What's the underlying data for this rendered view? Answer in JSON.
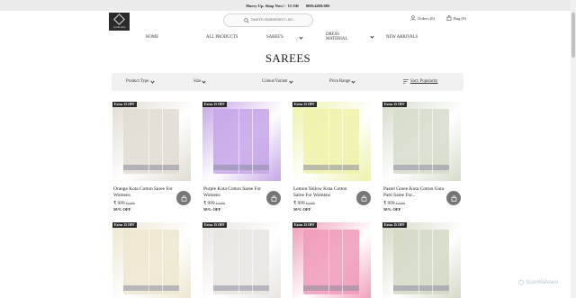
{
  "announcement": {
    "promo": "Hurry Up. Shop Now! - 15 Off",
    "countdown": "00H:44M:00S"
  },
  "header": {
    "logo_text": "HANDLOOM",
    "search_placeholder": "Search Handloom Clot...",
    "orders_label": "Orders (0)",
    "bag_label": "Bag (0)"
  },
  "nav": {
    "items": [
      {
        "label": "HOME"
      },
      {
        "label": "ALL PRODUCTS"
      },
      {
        "label": "SAREE'S"
      },
      {
        "label": "DRESS MATERIAL"
      },
      {
        "label": "NEW ARRIVALS"
      }
    ]
  },
  "page_title": "SAREES",
  "filters": {
    "product_type": "Product Type",
    "size": "Size",
    "colour": "Colour/Variant",
    "price": "Price Range",
    "sort": "Sort: Popularity"
  },
  "products": [
    {
      "badge": "Extra 15 OFF",
      "name": "Orange Kota Cotton Saree For Womens",
      "price": "999",
      "mrp": "2,000",
      "off": "50% OFF",
      "color": "#e0dcd1"
    },
    {
      "badge": "Extra 15 OFF",
      "name": "Purple Kota Cotton Saree For Womens",
      "price": "999",
      "mrp": "2,000",
      "off": "50% OFF",
      "color": "#c6a5e7"
    },
    {
      "badge": "Extra 15 OFF",
      "name": "Lemon Yellow Kota Cotton Saree For Womens",
      "price": "999",
      "mrp": "2,000",
      "off": "50% OFF",
      "color": "#eef2a8"
    },
    {
      "badge": "Extra 15 OFF",
      "name": "Pastel Green Kota Cotton Gota Patti Saree For...",
      "price": "999",
      "mrp": "2,000",
      "off": "50% OFF",
      "color": "#d6dccb"
    },
    {
      "badge": "Extra 15 OFF",
      "color": "#ede6cf"
    },
    {
      "badge": "Extra 15 OFF",
      "color": "#e8e4e0"
    },
    {
      "badge": "Extra 15 OFF",
      "color": "#f09ab8"
    },
    {
      "badge": "Extra 15 OFF",
      "color": "#d4d8c4"
    }
  ],
  "watermark": "ScanMalware",
  "colors": {
    "accent": "#2b2b2b",
    "filter_bg": "#f1f1f1",
    "cart_button": "#777777"
  }
}
